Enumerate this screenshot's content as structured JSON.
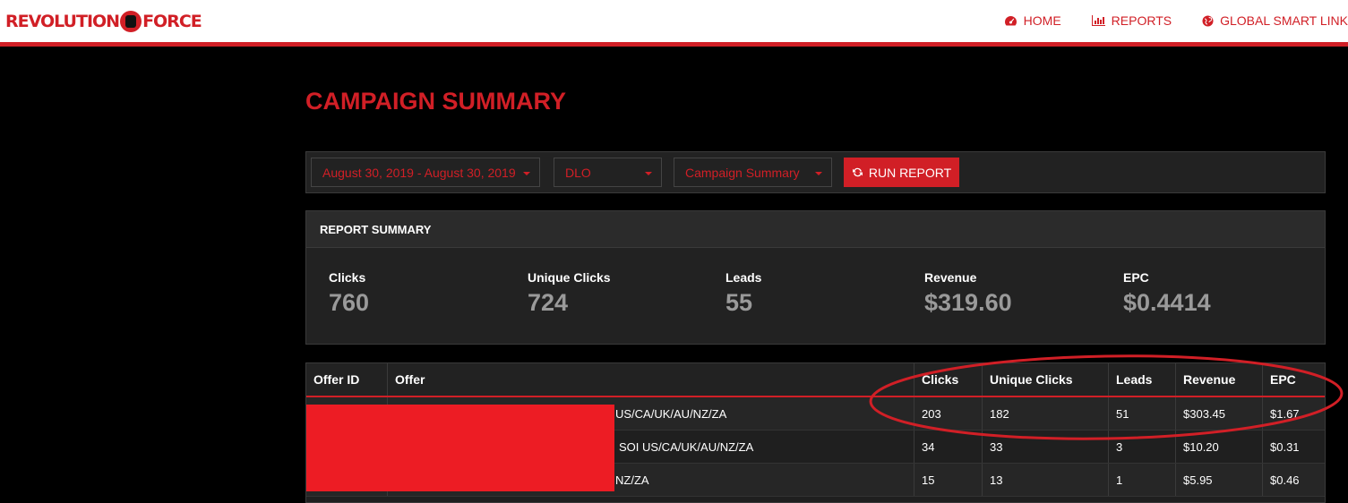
{
  "brand": {
    "logo_text_1": "REVOLUTION",
    "logo_text_2": "FORCE"
  },
  "nav": [
    {
      "label": "HOME",
      "icon": "dashboard-icon"
    },
    {
      "label": "REPORTS",
      "icon": "bar-chart-icon"
    },
    {
      "label": "GLOBAL SMART LINK",
      "icon": "globe-icon"
    }
  ],
  "page_title": "CAMPAIGN SUMMARY",
  "filters": {
    "date_range": "August 30, 2019 - August 30, 2019",
    "account": "DLO",
    "report_type": "Campaign Summary",
    "run_label": "RUN REPORT"
  },
  "summary": {
    "title": "REPORT SUMMARY",
    "stats": [
      {
        "label": "Clicks",
        "value": "760"
      },
      {
        "label": "Unique Clicks",
        "value": "724"
      },
      {
        "label": "Leads",
        "value": "55"
      },
      {
        "label": "Revenue",
        "value": "$319.60"
      },
      {
        "label": "EPC",
        "value": "$0.4414"
      }
    ]
  },
  "table": {
    "headers": [
      "Offer ID",
      "Offer",
      "Clicks",
      "Unique Clicks",
      "Leads",
      "Revenue",
      "EPC"
    ],
    "rows": [
      {
        "offer_id": "",
        "offer": "US/CA/UK/AU/NZ/ZA",
        "clicks": "203",
        "unique_clicks": "182",
        "leads": "51",
        "revenue": "$303.45",
        "epc": "$1.67"
      },
      {
        "offer_id": "",
        "offer": "SOI US/CA/UK/AU/NZ/ZA",
        "clicks": "34",
        "unique_clicks": "33",
        "leads": "3",
        "revenue": "$10.20",
        "epc": "$0.31"
      },
      {
        "offer_id": "",
        "offer": "NZ/ZA",
        "clicks": "15",
        "unique_clicks": "13",
        "leads": "1",
        "revenue": "$5.95",
        "epc": "$0.46"
      }
    ]
  },
  "colors": {
    "accent": "#d11f26",
    "panel": "#222222",
    "background": "#000000",
    "redaction": "#ed1c24"
  }
}
